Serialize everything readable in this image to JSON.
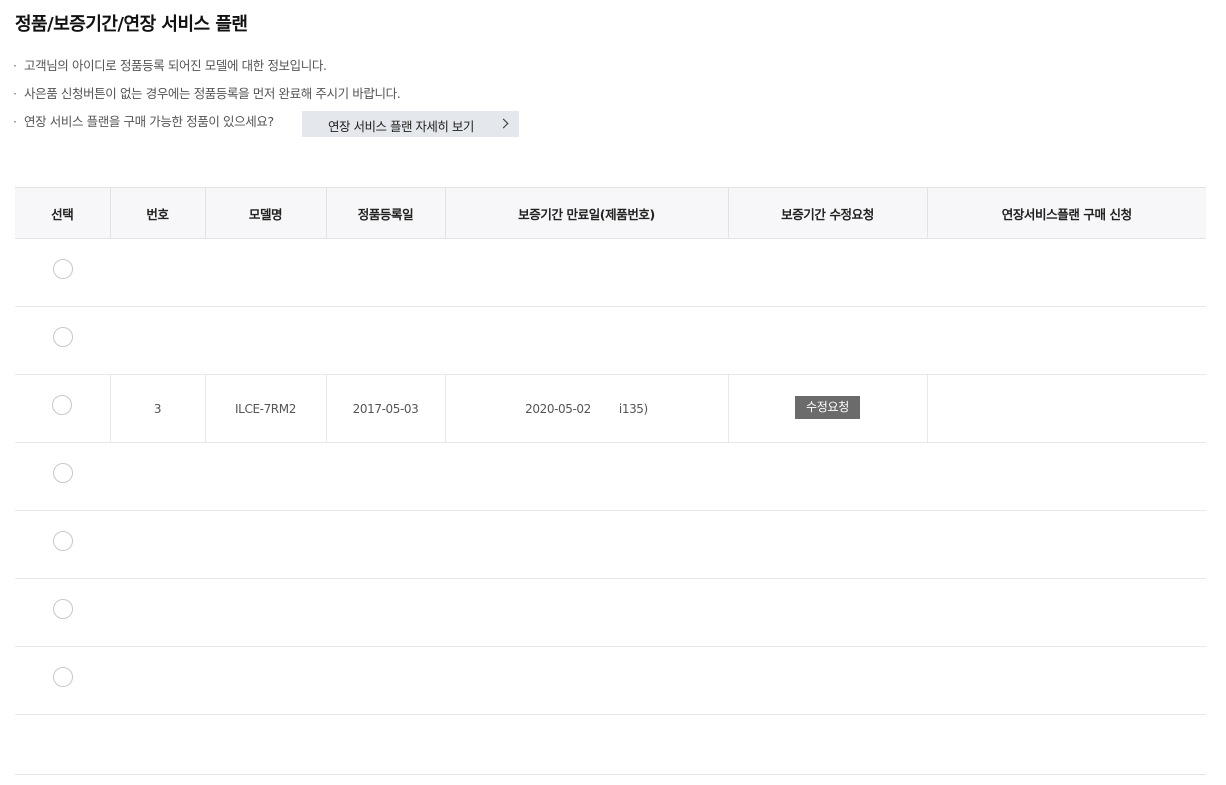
{
  "page": {
    "title": "정품/보증기간/연장 서비스 플랜"
  },
  "notices": [
    "고객님의 아이디로 정품등록 되어진 모델에 대한 정보입니다.",
    "사은품 신청버튼이 없는 경우에는 정품등록을 먼저 완료해 주시기 바랍니다.",
    "연장 서비스 플랜을 구매 가능한 정품이 있으세요?"
  ],
  "bullet": "·",
  "detail_button": {
    "label": "연장 서비스 플랜 자세히 보기",
    "icon": "chevron-right-icon"
  },
  "table": {
    "headers": {
      "select": "선택",
      "number": "번호",
      "model": "모델명",
      "reg_date": "정품등록일",
      "warranty_end": "보증기간 만료일(제품번호)",
      "warranty_edit": "보증기간 수정요청",
      "ext_plan": "연장서비스플랜 구매 신청"
    },
    "highlighted_row": {
      "number": "3",
      "model": "ILCE-7RM2",
      "reg_date": "2017-05-03",
      "warranty_end": "2020-05-02",
      "serial_fragment": "i135)",
      "edit_button": "수정요청"
    }
  },
  "colors": {
    "header_bg": "#f7f7f9",
    "button_bg": "#e4e7eb",
    "edit_button_bg": "#6b6b6b",
    "border": "#e3e3e3"
  }
}
